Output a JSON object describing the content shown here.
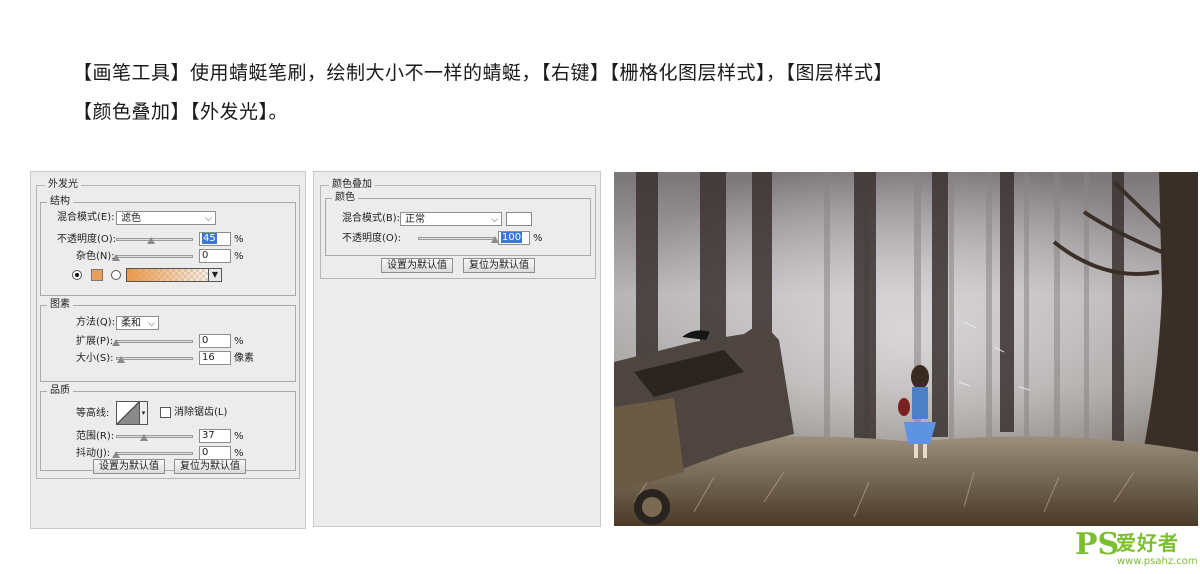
{
  "instructions": {
    "line1": "【画笔工具】使用蜻蜓笔刷，绘制大小不一样的蜻蜓，【右键】【栅格化图层样式】，【图层样式】",
    "line2": "【颜色叠加】【外发光】。"
  },
  "outer_glow": {
    "title": "外发光",
    "structure": {
      "title": "结构",
      "blend_mode_label": "混合模式(E):",
      "blend_mode_value": "滤色",
      "opacity_label": "不透明度(O):",
      "opacity_value": "45",
      "opacity_fraction": 0.45,
      "noise_label": "杂色(N):",
      "noise_value": "0",
      "noise_fraction": 0,
      "unit": "%"
    },
    "elements": {
      "title": "图素",
      "technique_label": "方法(Q):",
      "technique_value": "柔和",
      "spread_label": "扩展(P):",
      "spread_value": "0",
      "spread_fraction": 0,
      "size_label": "大小(S):",
      "size_value": "16",
      "size_fraction": 0.06,
      "size_unit": "像素",
      "unit": "%"
    },
    "quality": {
      "title": "品质",
      "contour_label": "等高线:",
      "antialias_label": "消除锯齿(L)",
      "range_label": "范围(R):",
      "range_value": "37",
      "range_fraction": 0.37,
      "jitter_label": "抖动(J):",
      "jitter_value": "0",
      "jitter_fraction": 0,
      "unit": "%"
    },
    "buttons": {
      "make_default": "设置为默认值",
      "reset_default": "复位为默认值"
    },
    "colors": {
      "swatch": "#e8a058",
      "gradient_start": "#e8984a"
    }
  },
  "color_overlay": {
    "title": "颜色叠加",
    "color_group": {
      "title": "颜色",
      "blend_mode_label": "混合模式(B):",
      "blend_mode_value": "正常",
      "opacity_label": "不透明度(O):",
      "opacity_value": "100",
      "opacity_fraction": 1.0,
      "unit": "%",
      "swatch_color": "#ffffff"
    },
    "buttons": {
      "make_default": "设置为默认值",
      "reset_default": "复位为默认值"
    }
  },
  "watermark": {
    "brand": "PS",
    "site_name": "爱好者",
    "url": "www.psahz.com",
    "color": "#7cbf2e"
  }
}
